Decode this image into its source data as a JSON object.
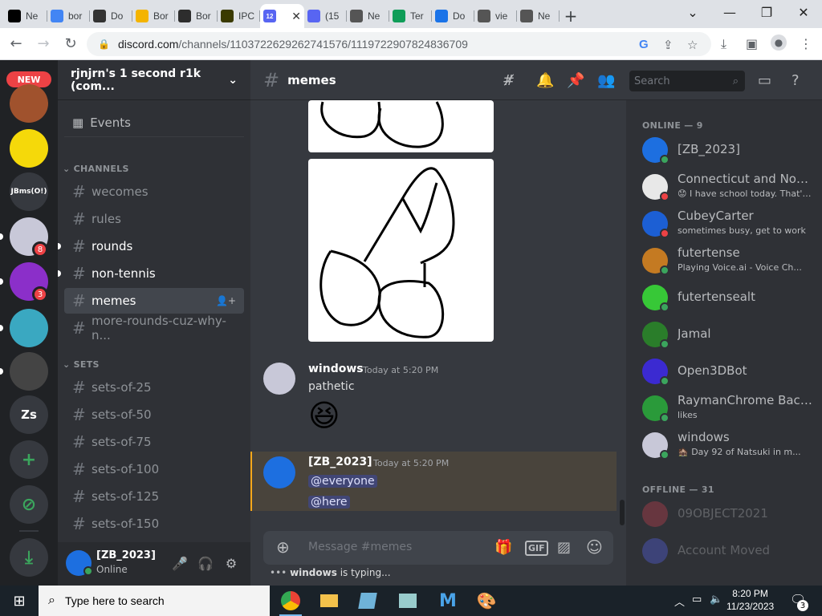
{
  "browser": {
    "tabs": [
      {
        "label": "Ne",
        "icon": "wiki-icon",
        "color": "#000000"
      },
      {
        "label": "bor",
        "icon": "google-icon",
        "color": "#4285f4"
      },
      {
        "label": "Do",
        "icon": "doc-icon",
        "color": "#333333"
      },
      {
        "label": "Bor",
        "icon": "app-icon",
        "color": "#f4b400"
      },
      {
        "label": "Bor",
        "icon": "grammar-icon",
        "color": "#2d2d2d"
      },
      {
        "label": "IPC",
        "icon": "ipc-icon",
        "color": "#3a3a00"
      },
      {
        "label": "12",
        "icon": "discord-icon",
        "color": "#5865f2",
        "active": true
      },
      {
        "label": "(15",
        "icon": "discord-icon",
        "color": "#5865f2"
      },
      {
        "label": "Ne",
        "icon": "chrome-icon",
        "color": "#555555"
      },
      {
        "label": "Ter",
        "icon": "terminal-icon",
        "color": "#0f9d58"
      },
      {
        "label": "Do",
        "icon": "download-icon",
        "color": "#1a73e8"
      },
      {
        "label": "vie",
        "icon": "chrome-icon",
        "color": "#555555"
      },
      {
        "label": "Ne",
        "icon": "chrome-icon",
        "color": "#555555"
      }
    ],
    "url_host": "discord.com",
    "url_path": "/channels/1103722629262741576/1119722907824836709"
  },
  "rail": {
    "new_badge": "NEW",
    "servers": [
      {
        "label": "",
        "icon": "food-server-icon",
        "color": "#a0522d"
      },
      {
        "label": "",
        "icon": "roblox-server-icon",
        "color": "#f5d90a"
      },
      {
        "label": "JBms(O!)",
        "icon": "text-server-icon",
        "color": "#36393f"
      },
      {
        "label": "",
        "icon": "anime-server-icon",
        "color": "#c8c8d8",
        "badge": "8"
      },
      {
        "label": "",
        "icon": "film-server-icon",
        "color": "#8b2fc9",
        "badge": "3"
      },
      {
        "label": "",
        "icon": "blob-server-icon",
        "color": "#3aa8c1"
      },
      {
        "label": "",
        "icon": "cat-server-icon",
        "color": "#444444"
      },
      {
        "label": "Zs",
        "icon": "text-server-icon",
        "color": "#36393f"
      }
    ]
  },
  "server": {
    "name": "rjnjrn's 1 second r1k (com...",
    "events_label": "Events",
    "categories": {
      "channels": "CHANNELS",
      "sets": "SETS"
    },
    "channels": [
      "wecomes",
      "rules",
      "rounds",
      "non-tennis",
      "memes",
      "more-rounds-cuz-why-n..."
    ],
    "sets": [
      "sets-of-25",
      "sets-of-50",
      "sets-of-75",
      "sets-of-100",
      "sets-of-125",
      "sets-of-150"
    ]
  },
  "user_panel": {
    "name": "[ZB_2023]",
    "status": "Online"
  },
  "chat": {
    "channel": "memes",
    "search_placeholder": "Search",
    "messages": [
      {
        "author": "windows",
        "time": "Today at 5:20 PM",
        "text": "pathetic",
        "emoji": "😆"
      },
      {
        "author": "[ZB_2023]",
        "time": "Today at 5:20 PM",
        "mentions": [
          "@everyone",
          "@here"
        ]
      }
    ],
    "composer_placeholder": "Message #memes",
    "typing_user": "windows",
    "typing_suffix": " is typing..."
  },
  "members": {
    "online_header": "ONLINE — 9",
    "offline_header": "OFFLINE — 31",
    "online": [
      {
        "name": "[ZB_2023]",
        "sub": "",
        "color": "#1d6fe0",
        "status": "online"
      },
      {
        "name": "Connecticut and Nort...",
        "sub": "😟 I have school today. That's ...",
        "color": "#e8e8e8",
        "status": "dnd"
      },
      {
        "name": "CubeyCarter",
        "sub": "sometimes busy, get to work",
        "color": "#1c5fd4",
        "status": "dnd"
      },
      {
        "name": "futertense",
        "sub": "Playing Voice.ai - Voice Ch...",
        "color": "#c47a22",
        "status": "online"
      },
      {
        "name": "futertensealt",
        "sub": "",
        "color": "#37c837",
        "status": "mobile"
      },
      {
        "name": "Jamal",
        "sub": "",
        "color": "#2a7d2a",
        "status": "online"
      },
      {
        "name": "Open3DBot",
        "sub": "",
        "color": "#3b2ad1",
        "status": "online"
      },
      {
        "name": "RaymanChrome Back...",
        "sub": "likes",
        "color": "#2a9a3a",
        "status": "online"
      },
      {
        "name": "windows",
        "sub": "🏚️ Day 92 of Natsuki in m...",
        "color": "#c8c8d8",
        "status": "mobile"
      }
    ],
    "offline": [
      {
        "name": "09OBJECT2021",
        "color": "#d04050"
      },
      {
        "name": "Account Moved",
        "color": "#5865f2"
      }
    ]
  },
  "taskbar": {
    "search_placeholder": "Type here to search",
    "time": "8:20 PM",
    "date": "11/23/2023",
    "notifications": "3"
  }
}
